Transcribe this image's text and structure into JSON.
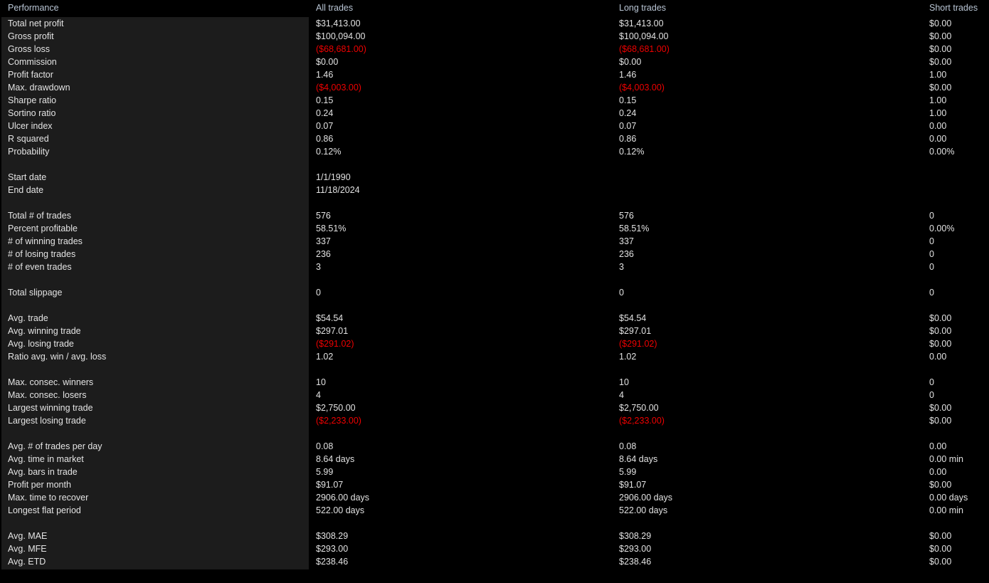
{
  "header": {
    "label_column": "Performance",
    "all_trades": "All trades",
    "long_trades": "Long trades",
    "short_trades": "Short trades"
  },
  "colors": {
    "background": "#000000",
    "label_panel": "#1c1c1c",
    "header_text": "#b9c5d4",
    "value_text": "#e2e2e2",
    "negative_text": "#ee0000"
  },
  "groups": [
    {
      "rows": [
        {
          "label": "Total net profit",
          "all": "$31,413.00",
          "long": "$31,413.00",
          "short": "$0.00"
        },
        {
          "label": "Gross profit",
          "all": "$100,094.00",
          "long": "$100,094.00",
          "short": "$0.00"
        },
        {
          "label": "Gross loss",
          "all": "($68,681.00)",
          "long": "($68,681.00)",
          "short": "$0.00",
          "neg": [
            "all",
            "long"
          ]
        },
        {
          "label": "Commission",
          "all": "$0.00",
          "long": "$0.00",
          "short": "$0.00"
        },
        {
          "label": "Profit factor",
          "all": "1.46",
          "long": "1.46",
          "short": "1.00"
        },
        {
          "label": "Max. drawdown",
          "all": "($4,003.00)",
          "long": "($4,003.00)",
          "short": "$0.00",
          "neg": [
            "all",
            "long"
          ]
        },
        {
          "label": "Sharpe ratio",
          "all": "0.15",
          "long": "0.15",
          "short": "1.00"
        },
        {
          "label": "Sortino ratio",
          "all": "0.24",
          "long": "0.24",
          "short": "1.00"
        },
        {
          "label": "Ulcer index",
          "all": "0.07",
          "long": "0.07",
          "short": "0.00"
        },
        {
          "label": "R squared",
          "all": "0.86",
          "long": "0.86",
          "short": "0.00"
        },
        {
          "label": "Probability",
          "all": "0.12%",
          "long": "0.12%",
          "short": "0.00%"
        }
      ]
    },
    {
      "rows": [
        {
          "label": "Start date",
          "all": "1/1/1990",
          "long": "",
          "short": ""
        },
        {
          "label": "End date",
          "all": "11/18/2024",
          "long": "",
          "short": ""
        }
      ]
    },
    {
      "rows": [
        {
          "label": "Total # of trades",
          "all": "576",
          "long": "576",
          "short": "0"
        },
        {
          "label": "Percent profitable",
          "all": "58.51%",
          "long": "58.51%",
          "short": "0.00%"
        },
        {
          "label": "# of winning trades",
          "all": "337",
          "long": "337",
          "short": "0"
        },
        {
          "label": "# of losing trades",
          "all": "236",
          "long": "236",
          "short": "0"
        },
        {
          "label": "# of even trades",
          "all": "3",
          "long": "3",
          "short": "0"
        }
      ]
    },
    {
      "rows": [
        {
          "label": "Total slippage",
          "all": "0",
          "long": "0",
          "short": "0"
        }
      ]
    },
    {
      "rows": [
        {
          "label": "Avg. trade",
          "all": "$54.54",
          "long": "$54.54",
          "short": "$0.00"
        },
        {
          "label": "Avg. winning trade",
          "all": "$297.01",
          "long": "$297.01",
          "short": "$0.00"
        },
        {
          "label": "Avg. losing trade",
          "all": "($291.02)",
          "long": "($291.02)",
          "short": "$0.00",
          "neg": [
            "all",
            "long"
          ]
        },
        {
          "label": "Ratio avg. win / avg. loss",
          "all": "1.02",
          "long": "1.02",
          "short": "0.00"
        }
      ]
    },
    {
      "rows": [
        {
          "label": "Max. consec. winners",
          "all": "10",
          "long": "10",
          "short": "0"
        },
        {
          "label": "Max. consec. losers",
          "all": "4",
          "long": "4",
          "short": "0"
        },
        {
          "label": "Largest winning trade",
          "all": "$2,750.00",
          "long": "$2,750.00",
          "short": "$0.00"
        },
        {
          "label": "Largest losing trade",
          "all": "($2,233.00)",
          "long": "($2,233.00)",
          "short": "$0.00",
          "neg": [
            "all",
            "long"
          ]
        }
      ]
    },
    {
      "rows": [
        {
          "label": "Avg. # of trades per day",
          "all": "0.08",
          "long": "0.08",
          "short": "0.00"
        },
        {
          "label": "Avg. time in market",
          "all": "8.64 days",
          "long": "8.64 days",
          "short": "0.00 min"
        },
        {
          "label": "Avg. bars in trade",
          "all": "5.99",
          "long": "5.99",
          "short": "0.00"
        },
        {
          "label": "Profit per month",
          "all": "$91.07",
          "long": "$91.07",
          "short": "$0.00"
        },
        {
          "label": "Max. time to recover",
          "all": "2906.00 days",
          "long": "2906.00 days",
          "short": "0.00 days"
        },
        {
          "label": "Longest flat period",
          "all": "522.00 days",
          "long": "522.00 days",
          "short": "0.00 min"
        }
      ]
    },
    {
      "rows": [
        {
          "label": "Avg. MAE",
          "all": "$308.29",
          "long": "$308.29",
          "short": "$0.00"
        },
        {
          "label": "Avg. MFE",
          "all": "$293.00",
          "long": "$293.00",
          "short": "$0.00"
        },
        {
          "label": "Avg. ETD",
          "all": "$238.46",
          "long": "$238.46",
          "short": "$0.00"
        }
      ]
    }
  ]
}
